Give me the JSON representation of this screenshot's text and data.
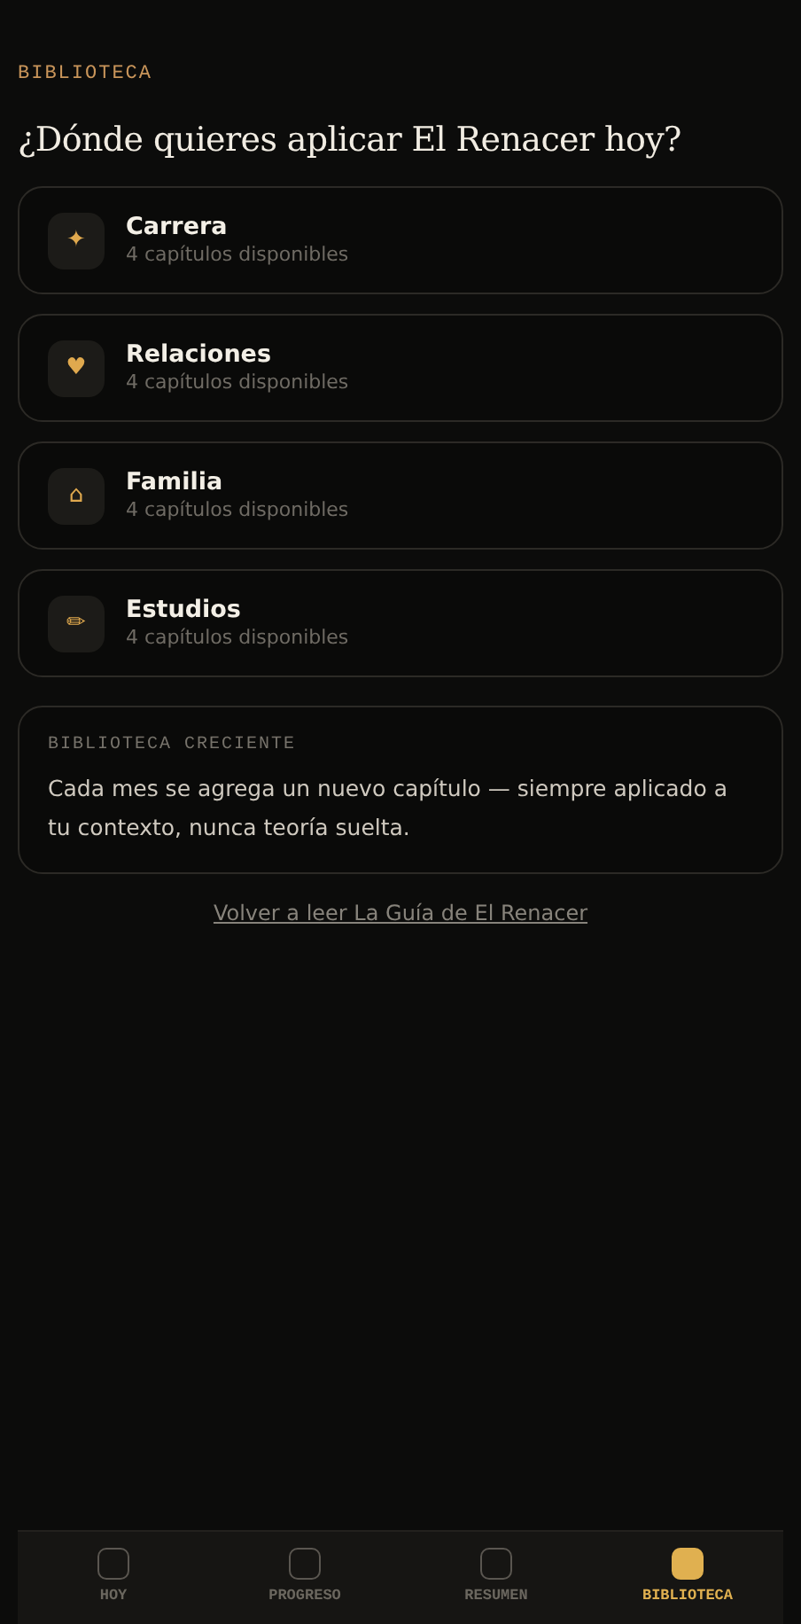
{
  "header": {
    "eyebrow": "BIBLIOTECA",
    "title": "¿Dónde quieres aplicar El Renacer hoy?"
  },
  "categories": [
    {
      "icon": "✦",
      "title": "Carrera",
      "subtitle": "4 capítulos disponibles"
    },
    {
      "icon": "♥",
      "title": "Relaciones",
      "subtitle": "4 capítulos disponibles"
    },
    {
      "icon": "⌂",
      "title": "Familia",
      "subtitle": "4 capítulos disponibles"
    },
    {
      "icon": "✏",
      "title": "Estudios",
      "subtitle": "4 capítulos disponibles"
    }
  ],
  "info_card": {
    "label": "BIBLIOTECA CRECIENTE",
    "text": "Cada mes se agrega un nuevo capítulo — siempre aplicado a tu contexto, nunca teoría suelta."
  },
  "link": "Volver a leer La Guía de El Renacer",
  "nav": [
    {
      "label": "HOY",
      "selected": false
    },
    {
      "label": "PROGRESO",
      "selected": false
    },
    {
      "label": "RESUMEN",
      "selected": false
    },
    {
      "label": "BIBLIOTECA",
      "selected": true
    }
  ]
}
